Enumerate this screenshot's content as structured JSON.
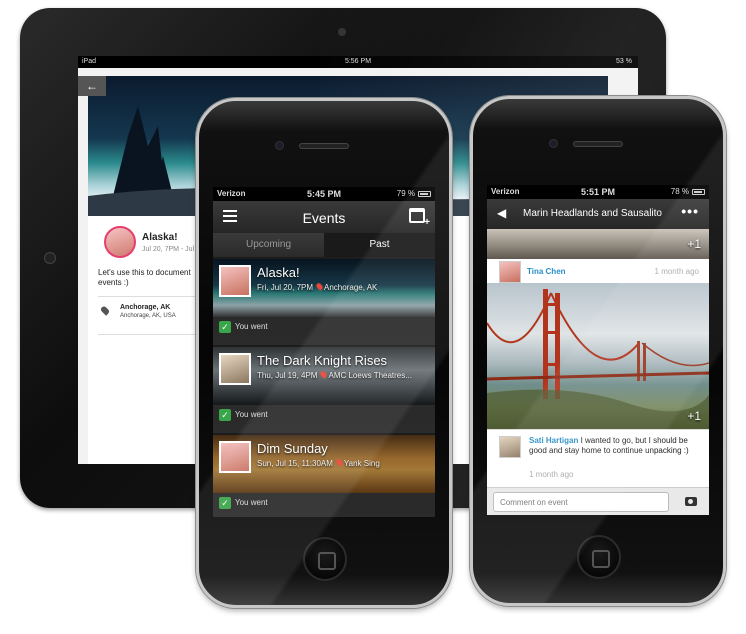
{
  "ipad": {
    "status": {
      "carrier": "iPad",
      "time": "5:56 PM",
      "battery": "53 %"
    },
    "event": {
      "title": "Alaska!",
      "subtitle": "Jul 20, 7PM - Jul 2",
      "description": "Let's use this to document events :)",
      "location_name": "Anchorage, AK",
      "location_detail": "Anchorage, AK, USA"
    }
  },
  "phone_left": {
    "status": {
      "carrier": "Verizon",
      "time": "5:45 PM",
      "battery": "79 %"
    },
    "header": {
      "title": "Events"
    },
    "tabs": [
      {
        "label": "Upcoming"
      },
      {
        "label": "Past"
      }
    ],
    "events": [
      {
        "name": "Alaska!",
        "date": "Fri, Jul 20, 7PM",
        "place": "Anchorage, AK",
        "status": "You went"
      },
      {
        "name": "The Dark Knight Rises",
        "date": "Thu, Jul 19, 4PM",
        "place": "AMC Loews Theatres...",
        "status": "You went"
      },
      {
        "name": "Dim Sunday",
        "date": "Sun, Jul 15, 11:30AM",
        "place": "Yank Sing",
        "status": "You went"
      }
    ]
  },
  "phone_right": {
    "status": {
      "carrier": "Verizon",
      "time": "5:51 PM",
      "battery": "78 %"
    },
    "header": {
      "title": "Marin Headlands and Sausalito"
    },
    "photo_count": "+1",
    "post": {
      "author": "Tina Chen",
      "ago": "1 month ago",
      "photo_count": "+1"
    },
    "comment": {
      "author": "Sati Hartigan",
      "text": "I wanted to go, but I should be good and stay home to continue unpacking :)",
      "ago": "1 month ago"
    },
    "compose": {
      "placeholder": "Comment on event"
    }
  }
}
